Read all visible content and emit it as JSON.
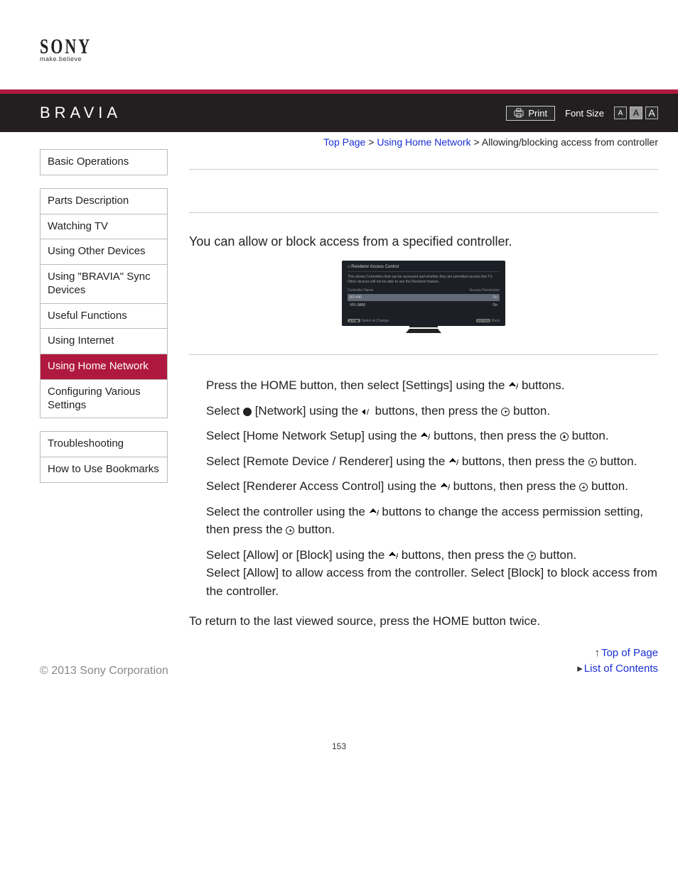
{
  "brand": {
    "logo": "SONY",
    "tagline": "make.believe",
    "product": "BRAVIA"
  },
  "toolbar": {
    "print_label": "Print",
    "font_size_label": "Font Size",
    "font_sizes": [
      "A",
      "A",
      "A"
    ]
  },
  "breadcrumb": {
    "top": "Top Page",
    "sep": ">",
    "mid": "Using Home Network",
    "current": "Allowing/blocking access from controller"
  },
  "sidebar": {
    "group1": [
      "Basic Operations"
    ],
    "group2": [
      "Parts Description",
      "Watching TV",
      "Using Other Devices",
      "Using \"BRAVIA\" Sync Devices",
      "Useful Functions",
      "Using Internet",
      "Using Home Network",
      "Configuring Various Settings"
    ],
    "group3": [
      "Troubleshooting",
      "How to Use Bookmarks"
    ],
    "active_index": 6
  },
  "intro": "You can allow or block access from a specified controller.",
  "tv_mock": {
    "title": "Renderer Access Control",
    "desc": "This shows Controllers that can be accessed and whether they are permitted access this TV. Other devices will not be able to use the Renderer feature.",
    "col1": "Controller Name",
    "col2": "Access Permission",
    "rows": [
      {
        "name": "BD-440",
        "perm": "On"
      },
      {
        "name": "VPL-5800",
        "perm": "On"
      }
    ],
    "foot_left_pill": "▲▼◀▶",
    "foot_left": "Select  ⊕ Change",
    "foot_right_pill": "RETURN",
    "foot_right": "Back"
  },
  "steps": {
    "s1a": "Press the HOME button, then select [Settings] using the ",
    "s1b": " buttons.",
    "s2a": "Select ",
    "s2b": " [Network] using the ",
    "s2c": " buttons, then press the ",
    "s2d": " button.",
    "s3a": "Select [Home Network Setup] using the ",
    "s3b": " buttons, then press the ",
    "s3c": " button.",
    "s4a": "Select [Remote Device / Renderer] using the ",
    "s4b": " buttons, then press the ",
    "s4c": " button.",
    "s5a": "Select [Renderer Access Control] using the ",
    "s5b": " buttons, then press the ",
    "s5c": " button.",
    "s6a": "Select the controller using the ",
    "s6b": " buttons to change the access permission setting, then press the ",
    "s6c": " button.",
    "s7a": "Select [Allow] or [Block] using the ",
    "s7b": " buttons, then press the ",
    "s7c": " button.",
    "s7note": "Select [Allow] to allow access from the controller. Select [Block] to block access from the controller."
  },
  "final_note": "To return to the last viewed source, press the HOME button twice.",
  "bottom_links": {
    "top": "Top of Page",
    "toc": "List of Contents"
  },
  "copyright": "© 2013 Sony Corporation",
  "page_number": "153"
}
